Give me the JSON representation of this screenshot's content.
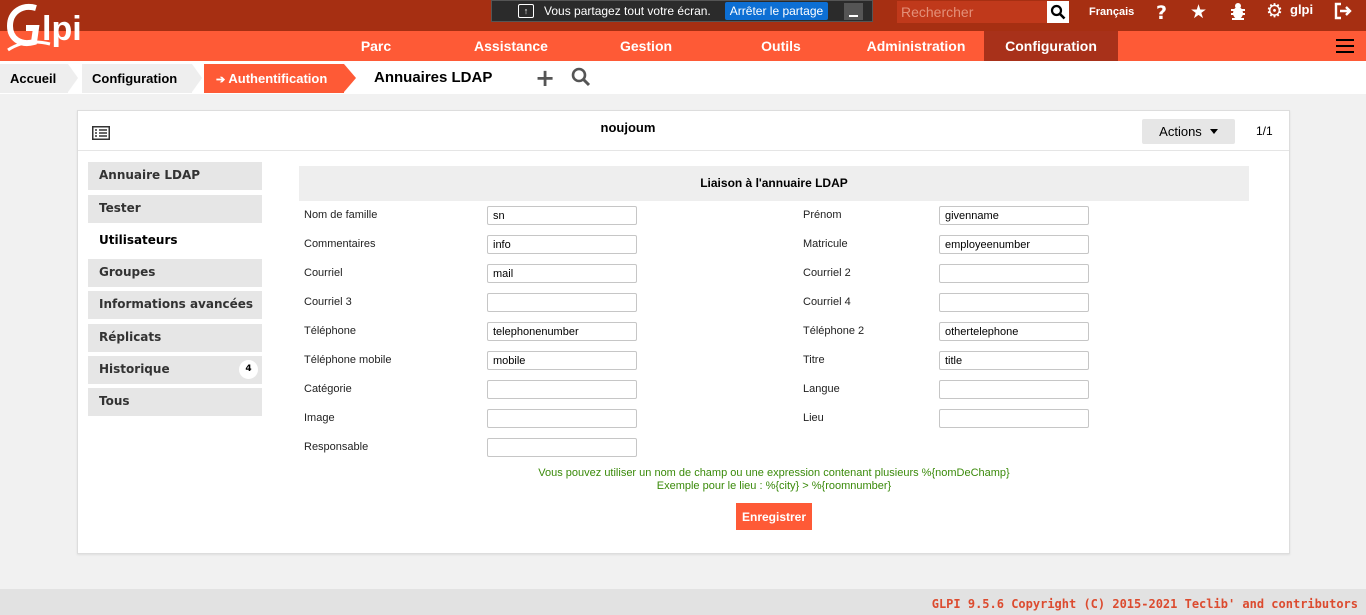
{
  "app": {
    "logo_text": "Glpi",
    "user_name": "glpi",
    "language": "Français"
  },
  "screen_share": {
    "message": "Vous partagez tout votre écran.",
    "stop_label": "Arrêter le partage"
  },
  "search": {
    "placeholder": "Rechercher"
  },
  "menu": {
    "items": [
      {
        "label": "Parc"
      },
      {
        "label": "Assistance"
      },
      {
        "label": "Gestion"
      },
      {
        "label": "Outils"
      },
      {
        "label": "Administration"
      },
      {
        "label": "Configuration",
        "active": true
      }
    ]
  },
  "breadcrumb": {
    "items": [
      "Accueil",
      "Configuration",
      "Authentification"
    ],
    "current": "Annuaires LDAP"
  },
  "record": {
    "name": "noujoum",
    "actions_label": "Actions",
    "pager": "1/1"
  },
  "tabs": [
    {
      "label": "Annuaire LDAP"
    },
    {
      "label": "Tester"
    },
    {
      "label": "Utilisateurs",
      "active": true
    },
    {
      "label": "Groupes"
    },
    {
      "label": "Informations avancées"
    },
    {
      "label": "Réplicats"
    },
    {
      "label": "Historique",
      "badge": "4"
    },
    {
      "label": "Tous"
    }
  ],
  "form": {
    "title": "Liaison à l'annuaire LDAP",
    "left": [
      {
        "label": "Nom de famille",
        "value": "sn"
      },
      {
        "label": "Commentaires",
        "value": "info"
      },
      {
        "label": "Courriel",
        "value": "mail"
      },
      {
        "label": "Courriel 3",
        "value": ""
      },
      {
        "label": "Téléphone",
        "value": "telephonenumber"
      },
      {
        "label": "Téléphone mobile",
        "value": "mobile"
      },
      {
        "label": "Catégorie",
        "value": ""
      },
      {
        "label": "Image",
        "value": ""
      },
      {
        "label": "Responsable",
        "value": ""
      }
    ],
    "right": [
      {
        "label": "Prénom",
        "value": "givenname"
      },
      {
        "label": "Matricule",
        "value": "employeenumber"
      },
      {
        "label": "Courriel 2",
        "value": ""
      },
      {
        "label": "Courriel 4",
        "value": ""
      },
      {
        "label": "Téléphone 2",
        "value": "othertelephone"
      },
      {
        "label": "Titre",
        "value": "title"
      },
      {
        "label": "Langue",
        "value": ""
      },
      {
        "label": "Lieu",
        "value": ""
      }
    ],
    "hint_line1": "Vous pouvez utiliser un nom de champ ou une expression contenant plusieurs %{nomDeChamp}",
    "hint_line2": "Exemple pour le lieu : %{city} > %{roomnumber}",
    "save_label": "Enregistrer"
  },
  "footer": {
    "text": "GLPI 9.5.6 Copyright (C) 2015-2021 Teclib' and contributors"
  },
  "colors": {
    "brand_dark": "#a62f12",
    "brand": "#fe5a36",
    "hint_green": "#3a8a0a"
  }
}
